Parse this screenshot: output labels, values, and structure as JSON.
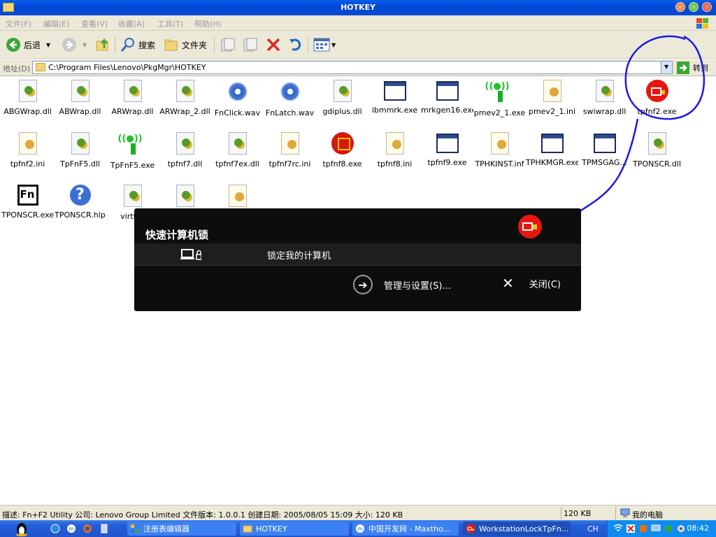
{
  "window": {
    "title": "HOTKEY"
  },
  "menu": [
    "文件(F)",
    "编辑(E)",
    "查看(V)",
    "收藏(A)",
    "工具(T)",
    "帮助(H)"
  ],
  "toolbar": {
    "back": "后退",
    "search": "搜索",
    "folders": "文件夹"
  },
  "address": {
    "label": "地址(D)",
    "path": "C:\\Program Files\\Lenovo\\PkgMgr\\HOTKEY",
    "go": "转到"
  },
  "files": [
    {
      "name": "ABGWrap.dll",
      "type": "dll"
    },
    {
      "name": "ABWrap.dll",
      "type": "dll"
    },
    {
      "name": "ARWrap.dll",
      "type": "dll"
    },
    {
      "name": "ARWrap_2.dll",
      "type": "dll"
    },
    {
      "name": "FnClick.wav",
      "type": "wav"
    },
    {
      "name": "FnLatch.wav",
      "type": "wav"
    },
    {
      "name": "gdiplus.dll",
      "type": "dll"
    },
    {
      "name": "ibmmrk.exe",
      "type": "exe"
    },
    {
      "name": "mrkgen16.exe",
      "type": "exe"
    },
    {
      "name": "pmev2_1.exe",
      "type": "antenna"
    },
    {
      "name": "pmev2_1.ini",
      "type": "ini"
    },
    {
      "name": "swiwrap.dll",
      "type": "dll"
    },
    {
      "name": "tpfnf2.exe",
      "type": "redlock"
    },
    {
      "name": "tpfnf2.ini",
      "type": "ini"
    },
    {
      "name": "TpFnF5.dll",
      "type": "dll"
    },
    {
      "name": "TpFnF5.exe",
      "type": "antenna"
    },
    {
      "name": "tpfnf7.dll",
      "type": "dll"
    },
    {
      "name": "tpfnf7ex.dll",
      "type": "dll"
    },
    {
      "name": "tpfnf7rc.ini",
      "type": "ini"
    },
    {
      "name": "tpfnf8.exe",
      "type": "red8"
    },
    {
      "name": "tpfnf8.ini",
      "type": "ini"
    },
    {
      "name": "tpfnf9.exe",
      "type": "exe"
    },
    {
      "name": "TPHKINST.inf",
      "type": "ini"
    },
    {
      "name": "TPHKMGR.exe",
      "type": "exe"
    },
    {
      "name": "TPMSGAG...",
      "type": "exe"
    },
    {
      "name": "TPONSCR.dll",
      "type": "dll"
    },
    {
      "name": "TPONSCR.exe",
      "type": "fn"
    },
    {
      "name": "TPONSCR.hlp",
      "type": "hlp"
    },
    {
      "name": "virtfn_",
      "type": "dll"
    },
    {
      "name": "",
      "type": "dll"
    },
    {
      "name": "",
      "type": "ini"
    }
  ],
  "popup": {
    "title": "快速计算机锁",
    "lock_label": "锁定我的计算机",
    "manage_label": "管理与设置(S)...",
    "close_label": "关闭(C)"
  },
  "status": {
    "description": "描述: Fn+F2 Utility 公司: Lenovo Group Limited 文件版本: 1.0.0.1 创建日期: 2005/08/05 15:09 大小: 120 KB",
    "size": "120 KB",
    "location": "我的电脑"
  },
  "taskbar": {
    "tasks": [
      {
        "label": "注册表编辑器"
      },
      {
        "label": "HOTKEY"
      },
      {
        "label": "中国开发网 - Maxtho..."
      },
      {
        "label": "WorkstationLockTpFn..."
      }
    ],
    "lang": "CH",
    "clock": "08:42"
  },
  "colors": {
    "titlebar": "#0a5fe8",
    "popup_bg": "#0d0d0d",
    "annotation": "#1a1ae6"
  }
}
